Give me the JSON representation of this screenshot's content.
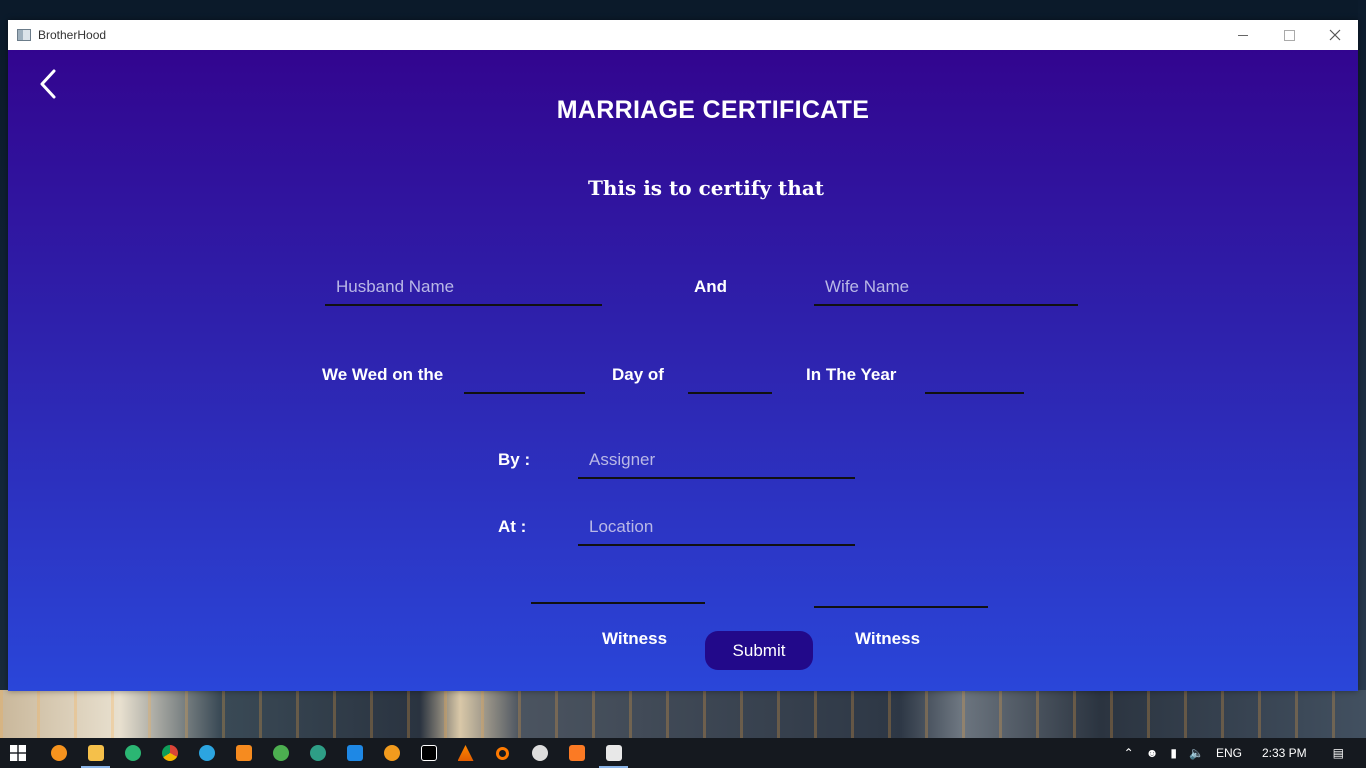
{
  "window": {
    "title": "BrotherHood"
  },
  "form": {
    "title": "MARRIAGE CERTIFICATE",
    "subtitle": "This is to certify that",
    "husband_placeholder": "Husband Name",
    "and_label": "And",
    "wife_placeholder": "Wife Name",
    "wed_label": "We Wed on the",
    "day_of_label": "Day of",
    "year_label": "In The Year",
    "by_label": "By :",
    "assigner_placeholder": "Assigner",
    "at_label": "At :",
    "location_placeholder": "Location",
    "witness1_label": "Witness",
    "witness2_label": "Witness",
    "submit_label": "Submit"
  },
  "taskbar": {
    "apps": [
      "app-g-icon",
      "file-explorer-icon",
      "edge-icon",
      "chrome-icon",
      "telegram-icon",
      "app-orange-icon",
      "app-green-icon",
      "app-teal-icon",
      "vscode-icon",
      "app-hexagon-icon",
      "intellij-icon",
      "vlc-icon",
      "search-app-icon",
      "obs-icon",
      "xampp-icon",
      "java-app-icon"
    ],
    "language": "ENG",
    "time": "2:33 PM"
  },
  "colors": {
    "gradient_top": "#32058f",
    "gradient_bottom": "#2a46d9",
    "submit_bg": "#22098a"
  }
}
